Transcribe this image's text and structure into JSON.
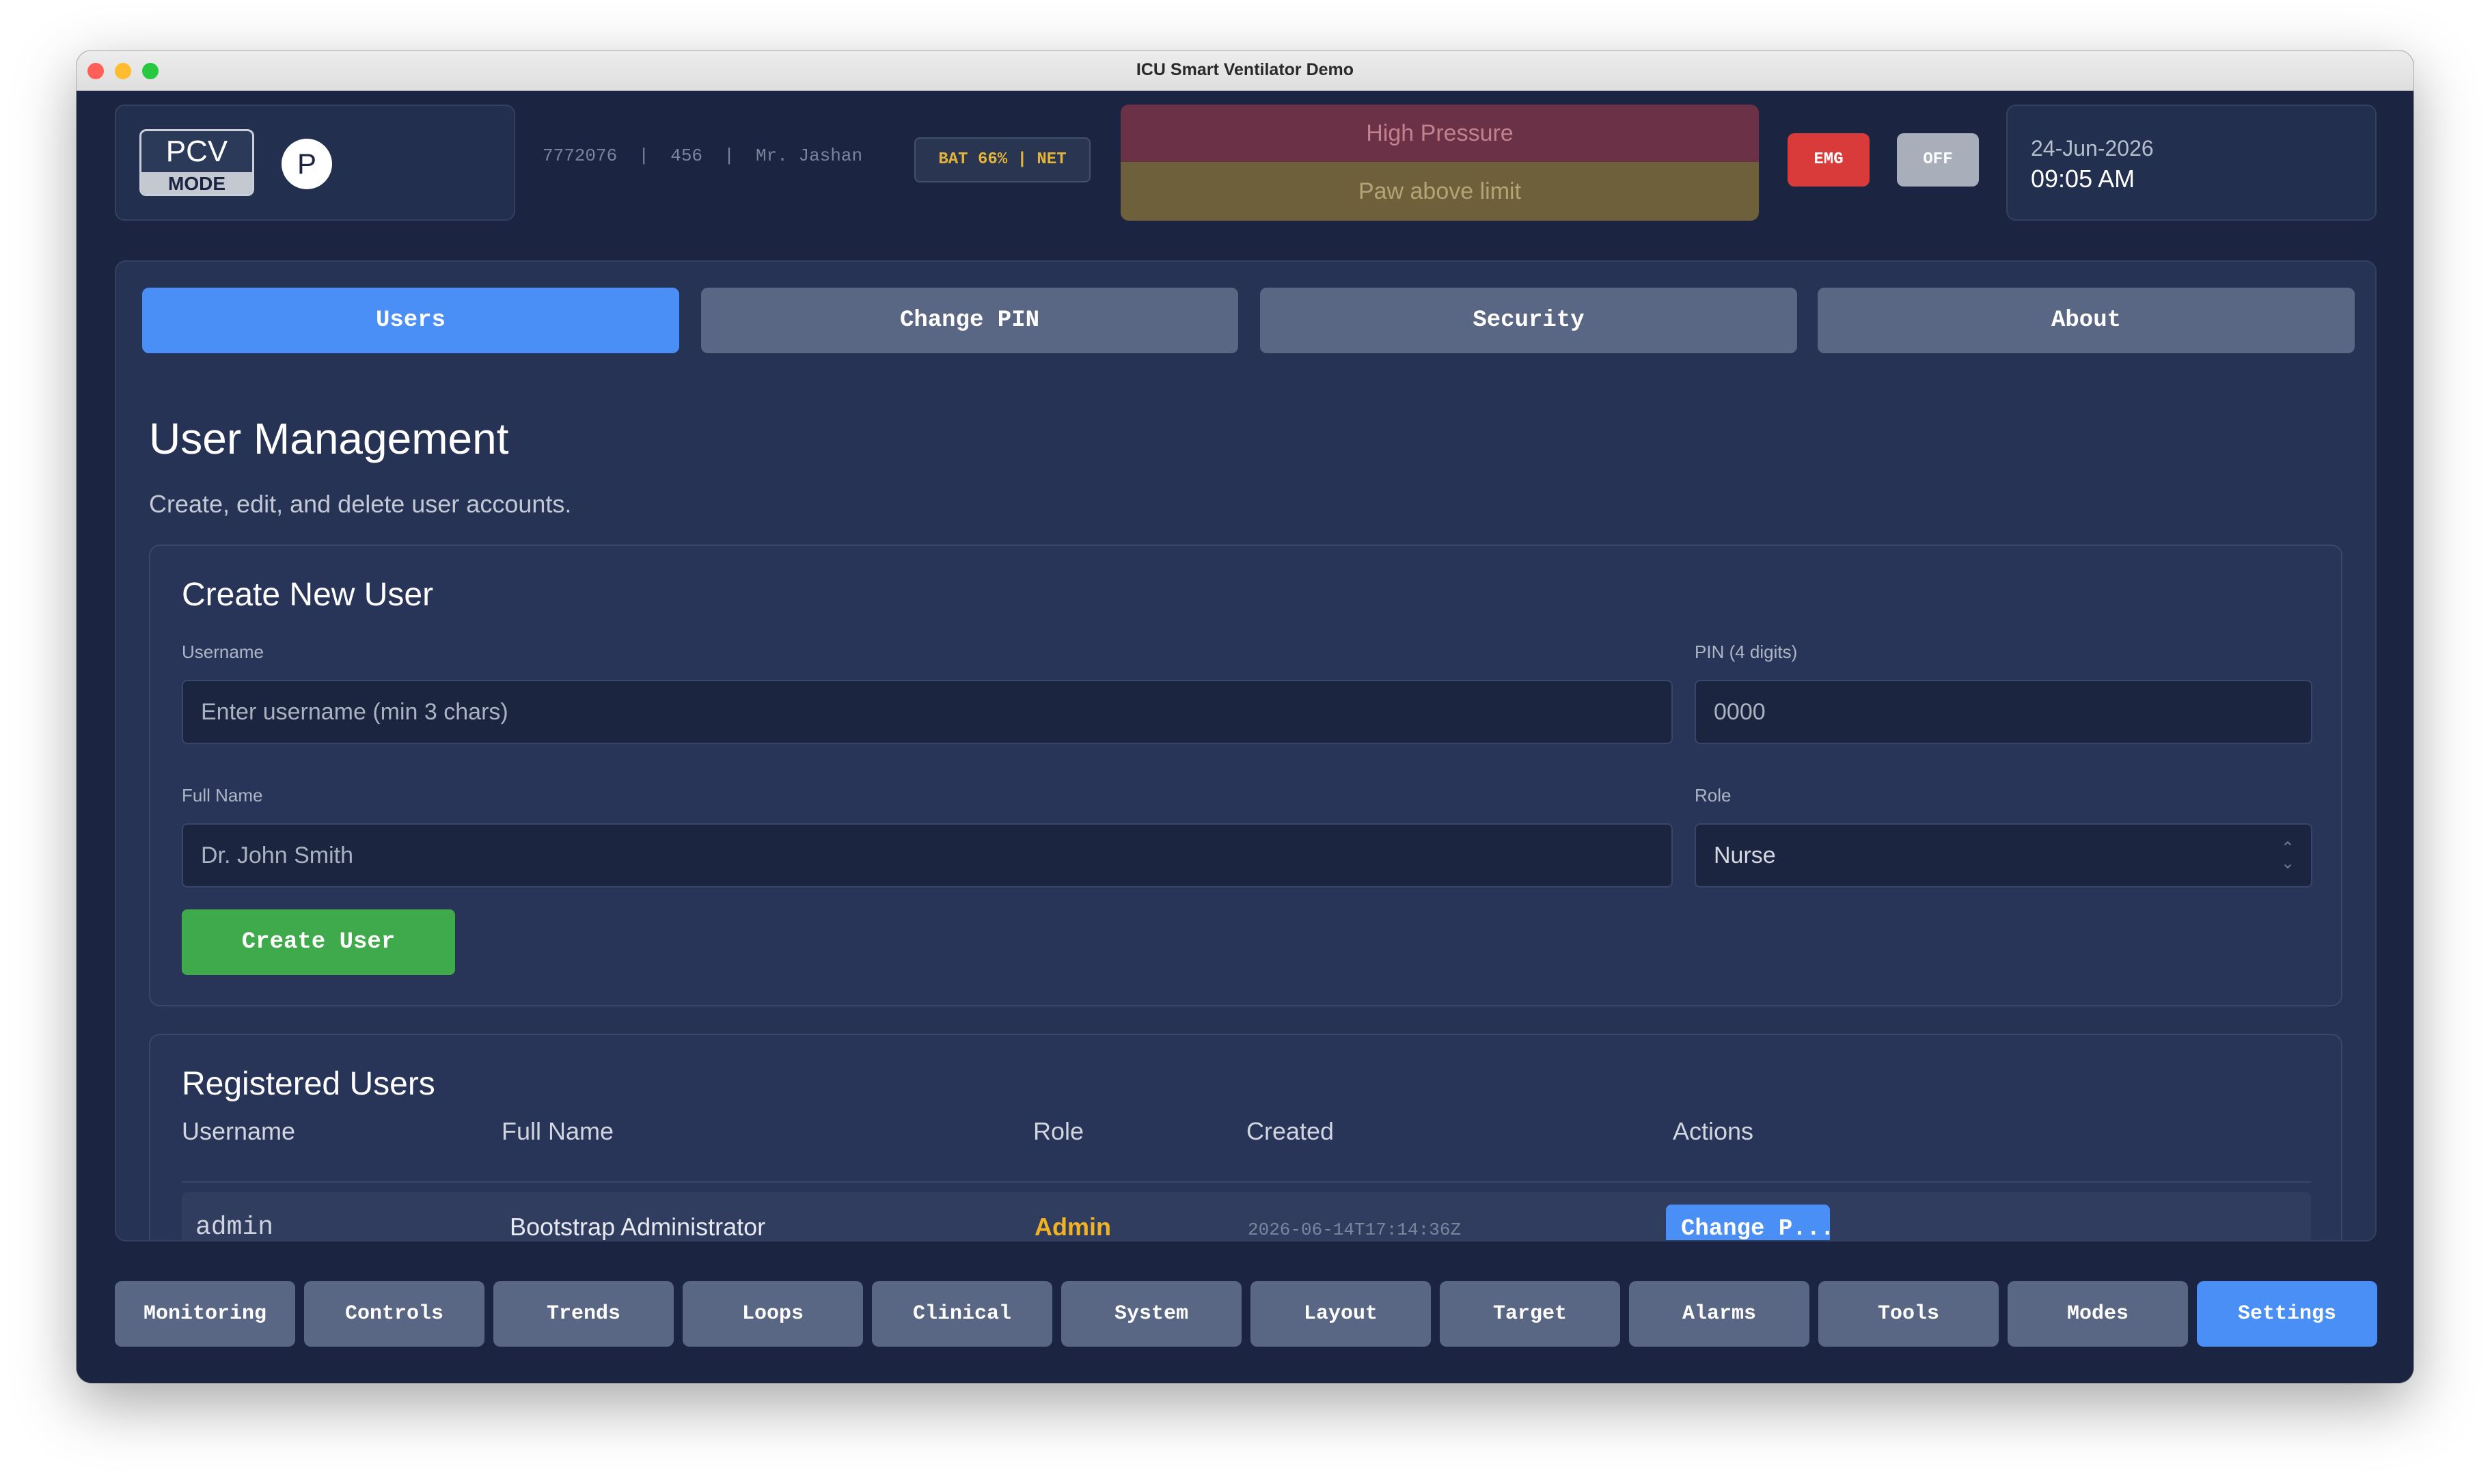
{
  "window": {
    "title": "ICU Smart Ventilator Demo"
  },
  "header": {
    "mode": {
      "name": "PCV",
      "label": "MODE"
    },
    "patient_initial": "P",
    "patient_info": "7772076  |  456  |  Mr. Jashan",
    "status_badge": "BAT 66% | NET",
    "alarms": [
      "High Pressure",
      "Paw above limit"
    ],
    "emg_label": "EMG",
    "off_label": "OFF",
    "date": "24-Jun-2026",
    "time": "09:05 AM"
  },
  "tabs": [
    {
      "label": "Users",
      "active": true
    },
    {
      "label": "Change PIN",
      "active": false
    },
    {
      "label": "Security",
      "active": false
    },
    {
      "label": "About",
      "active": false
    }
  ],
  "page": {
    "title": "User Management",
    "subtitle": "Create, edit, and delete user accounts."
  },
  "create_user": {
    "title": "Create New User",
    "username_label": "Username",
    "username_placeholder": "Enter username (min 3 chars)",
    "pin_label": "PIN (4 digits)",
    "pin_placeholder": "0000",
    "fullname_label": "Full Name",
    "fullname_placeholder": "Dr. John Smith",
    "role_label": "Role",
    "role_value": "Nurse",
    "submit_label": "Create User"
  },
  "registered_users": {
    "title": "Registered Users",
    "columns": [
      "Username",
      "Full Name",
      "Role",
      "Created",
      "Actions"
    ],
    "rows": [
      {
        "username": "admin",
        "full_name": "Bootstrap Administrator",
        "role": "Admin",
        "created": "2026-06-14T17:14:36Z",
        "action": "Change P..."
      }
    ]
  },
  "bottom_nav": [
    {
      "label": "Monitoring",
      "active": false
    },
    {
      "label": "Controls",
      "active": false
    },
    {
      "label": "Trends",
      "active": false
    },
    {
      "label": "Loops",
      "active": false
    },
    {
      "label": "Clinical",
      "active": false
    },
    {
      "label": "System",
      "active": false
    },
    {
      "label": "Layout",
      "active": false
    },
    {
      "label": "Target",
      "active": false
    },
    {
      "label": "Alarms",
      "active": false
    },
    {
      "label": "Tools",
      "active": false
    },
    {
      "label": "Modes",
      "active": false
    },
    {
      "label": "Settings",
      "active": true
    }
  ],
  "colors": {
    "accent": "#4a8ff5",
    "success": "#3faa4c",
    "danger": "#d93b3b",
    "role_admin": "#f2b322",
    "background": "#1b2440"
  }
}
